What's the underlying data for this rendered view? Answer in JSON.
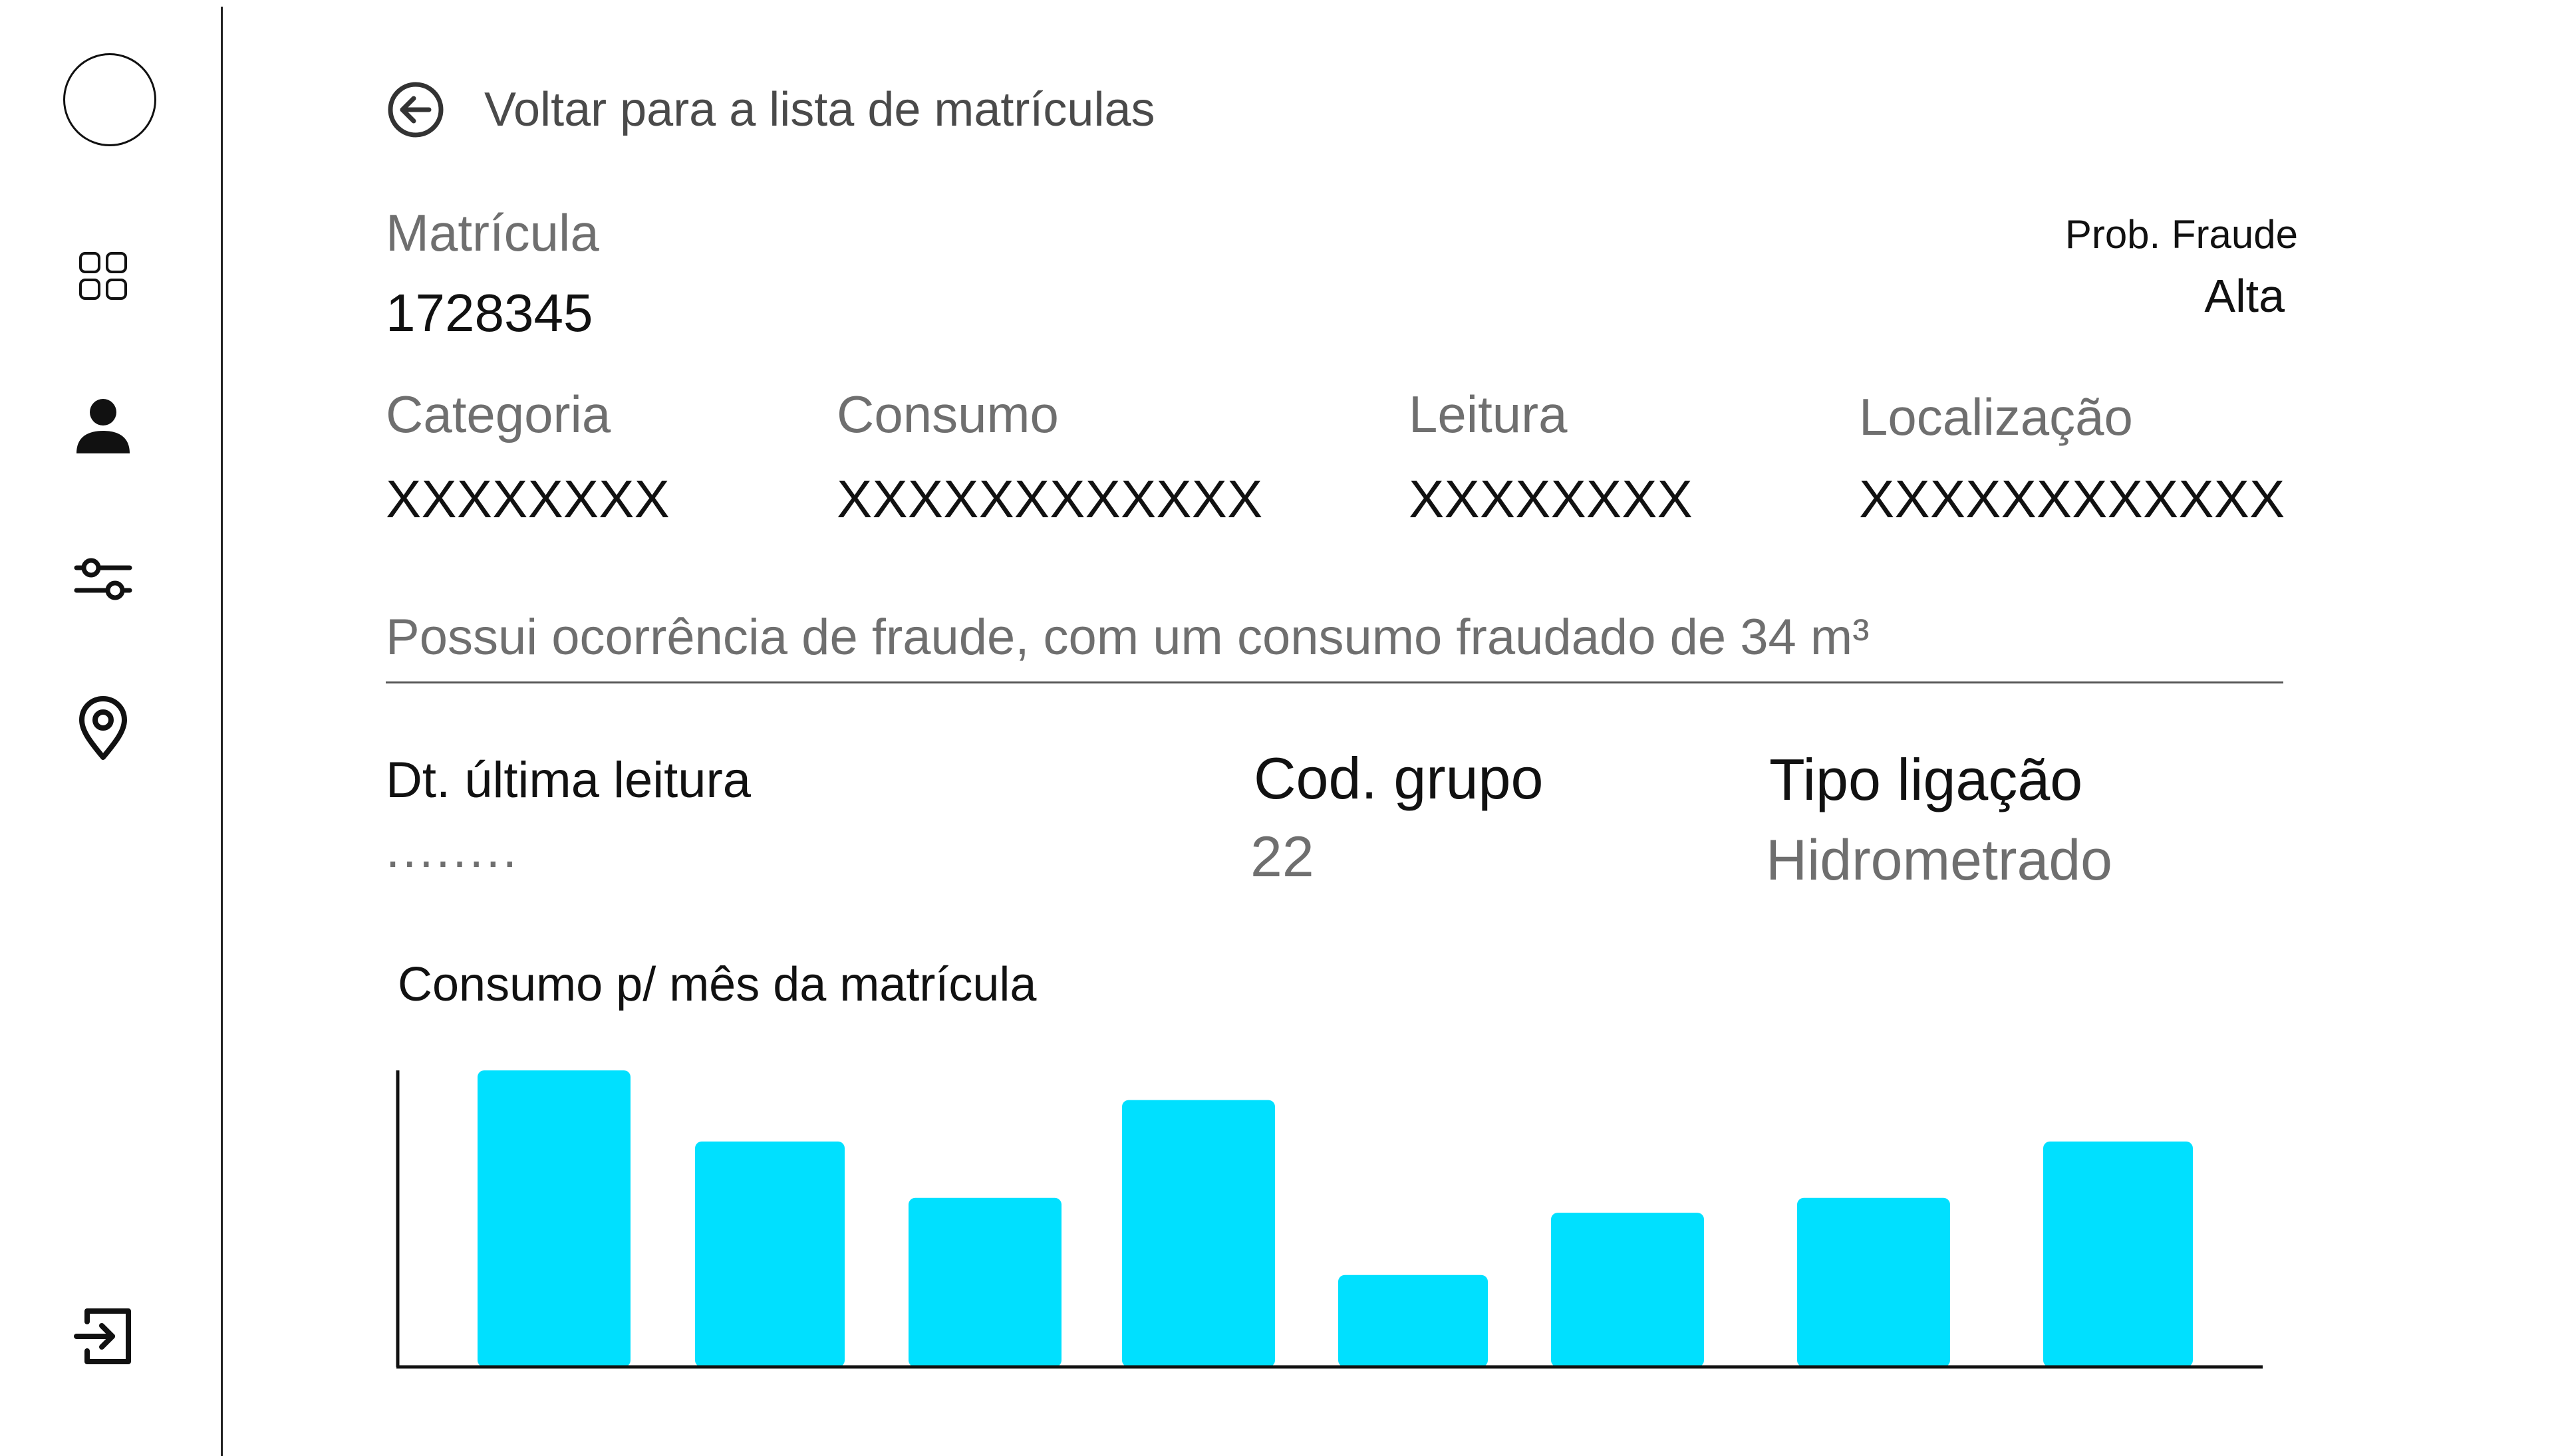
{
  "sidebar": {
    "icons": [
      "avatar-circle",
      "grid-icon",
      "user-icon",
      "sliders-icon",
      "location-pin-icon",
      "logout-icon"
    ]
  },
  "back_link": {
    "label": "Voltar para a lista de matrículas",
    "icon": "arrow-left-circle-icon"
  },
  "matricula": {
    "label": "Matrícula",
    "value": "1728345"
  },
  "fraud_probability": {
    "label": "Prob. Fraude",
    "value": "Alta"
  },
  "fields": [
    {
      "label": "Categoria",
      "value": "XXXXXXXX"
    },
    {
      "label": "Consumo",
      "value": "XXXXXXXXXXXX"
    },
    {
      "label": "Leitura",
      "value": "XXXXXXXX"
    },
    {
      "label": "Localização",
      "value": "XXXXXXXXXXXX"
    }
  ],
  "fraud_notice": "Possui ocorrência de fraude, com um consumo fraudado de 34 m³",
  "details": {
    "last_reading": {
      "label": "Dt. última leitura",
      "value": "........"
    },
    "group_code": {
      "label": "Cod. grupo",
      "value": "22"
    },
    "connection_type": {
      "label": "Tipo ligação",
      "value": "Hidrometrado"
    }
  },
  "chart_data": {
    "type": "bar",
    "title": "Consumo p/ mês da matrícula",
    "values": [
      100,
      76,
      57,
      90,
      31,
      52,
      57,
      76
    ],
    "ylim": [
      0,
      100
    ],
    "xlabel": "",
    "ylabel": "",
    "grid": false,
    "bar_color": "#00E0FF"
  },
  "colors": {
    "accent": "#00E0FF",
    "text": "#111111",
    "muted": "#6f6f6f"
  }
}
